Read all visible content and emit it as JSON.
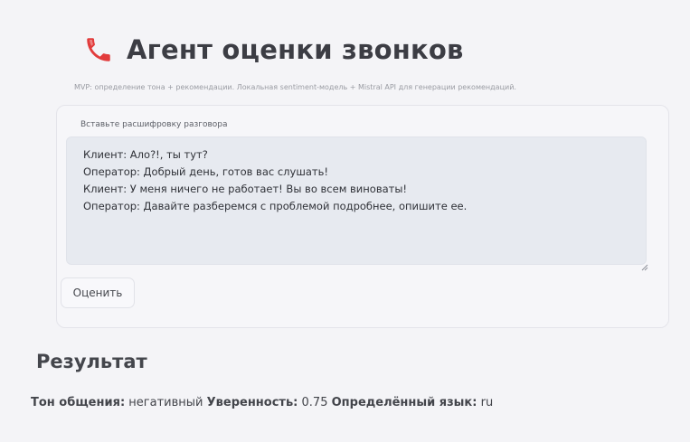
{
  "header": {
    "icon": "phone-icon",
    "title": "Агент оценки звонков",
    "subtitle": "MVP: определение тона + рекомендации. Локальная sentiment-модель + Mistral API для генерации рекомендаций."
  },
  "input": {
    "label": "Вставьте расшифровку разговора",
    "value": "Клиент: Ало?!, ты тут?\nОператор: Добрый день, готов вас слушать!\nКлиент: У меня ничего не работает! Вы во всем виноваты!\nОператор: Давайте разберемся с проблемой подробнее, опишите ее."
  },
  "actions": {
    "evaluate_label": "Оценить"
  },
  "result": {
    "heading": "Результат",
    "tone_label": "Тон общения:",
    "tone_value": "негативный",
    "confidence_label": "Уверенность:",
    "confidence_value": "0.75",
    "language_label": "Определённый язык:",
    "language_value": "ru"
  },
  "colors": {
    "background": "#f4f4f7",
    "textarea_background": "#e7eaf0",
    "icon_red": "#e23c3c",
    "text": "#2f3137"
  }
}
